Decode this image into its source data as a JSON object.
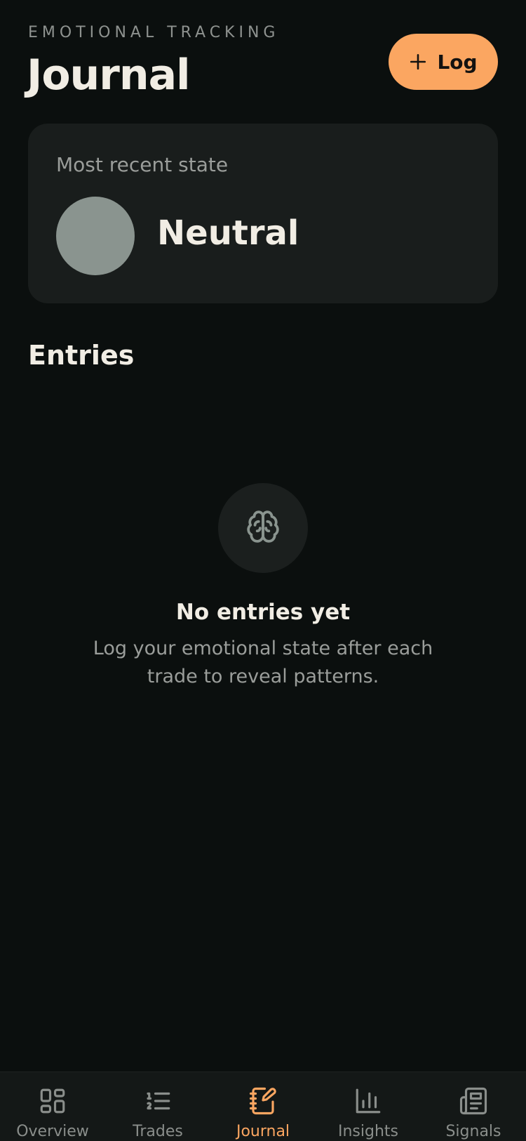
{
  "header": {
    "eyebrow": "EMOTIONAL TRACKING",
    "title": "Journal",
    "log_button_label": "Log"
  },
  "recent_state": {
    "label": "Most recent state",
    "value": "Neutral",
    "dot_color": "#8a948f"
  },
  "entries": {
    "section_title": "Entries",
    "empty_icon": "brain-icon",
    "empty_title": "No entries yet",
    "empty_text": "Log your emotional state after each trade to reveal patterns."
  },
  "tabbar": {
    "items": [
      {
        "label": "Overview",
        "icon": "grid-icon",
        "active": false
      },
      {
        "label": "Trades",
        "icon": "list-icon",
        "active": false
      },
      {
        "label": "Journal",
        "icon": "notebook-pen-icon",
        "active": true
      },
      {
        "label": "Insights",
        "icon": "bar-chart-icon",
        "active": false
      },
      {
        "label": "Signals",
        "icon": "newspaper-icon",
        "active": false
      }
    ]
  },
  "colors": {
    "background": "#0b0f0e",
    "card": "#191d1c",
    "accent": "#fba661",
    "text": "#f1ede4",
    "muted": "#9a9d9a"
  }
}
